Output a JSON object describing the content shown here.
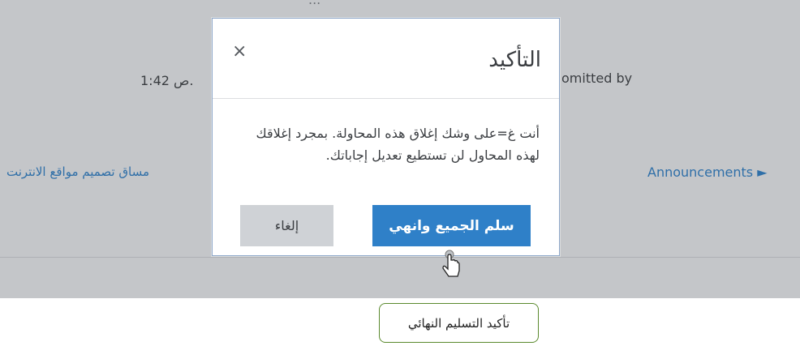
{
  "background": {
    "top_partial_text": "...",
    "time_text": "1:42 ص.",
    "submitted_text": "omitted by",
    "prev_link": "مساق تصميم مواقع الانترنت",
    "next_link": "Announcements ►"
  },
  "modal": {
    "title": "التأكيد",
    "close_glyph": "×",
    "body": "أنت غ=على وشك إغلاق هذه المحاولة. بمجرد إغلاقك لهذه المحاول لن تستطيع تعديل إجاباتك.",
    "confirm_label": "سلم الجميع وانهي",
    "cancel_label": "إلغاء"
  },
  "caption": "تأكيد التسليم النهائي",
  "colors": {
    "primary": "#2f80c8",
    "secondary": "#cfd2d6",
    "backdrop": "#c4c6c9",
    "link": "#2f6fa8",
    "caption_border": "#5b8a2e"
  },
  "icons": {
    "close": "close-icon",
    "cursor": "hand-pointer-icon"
  }
}
